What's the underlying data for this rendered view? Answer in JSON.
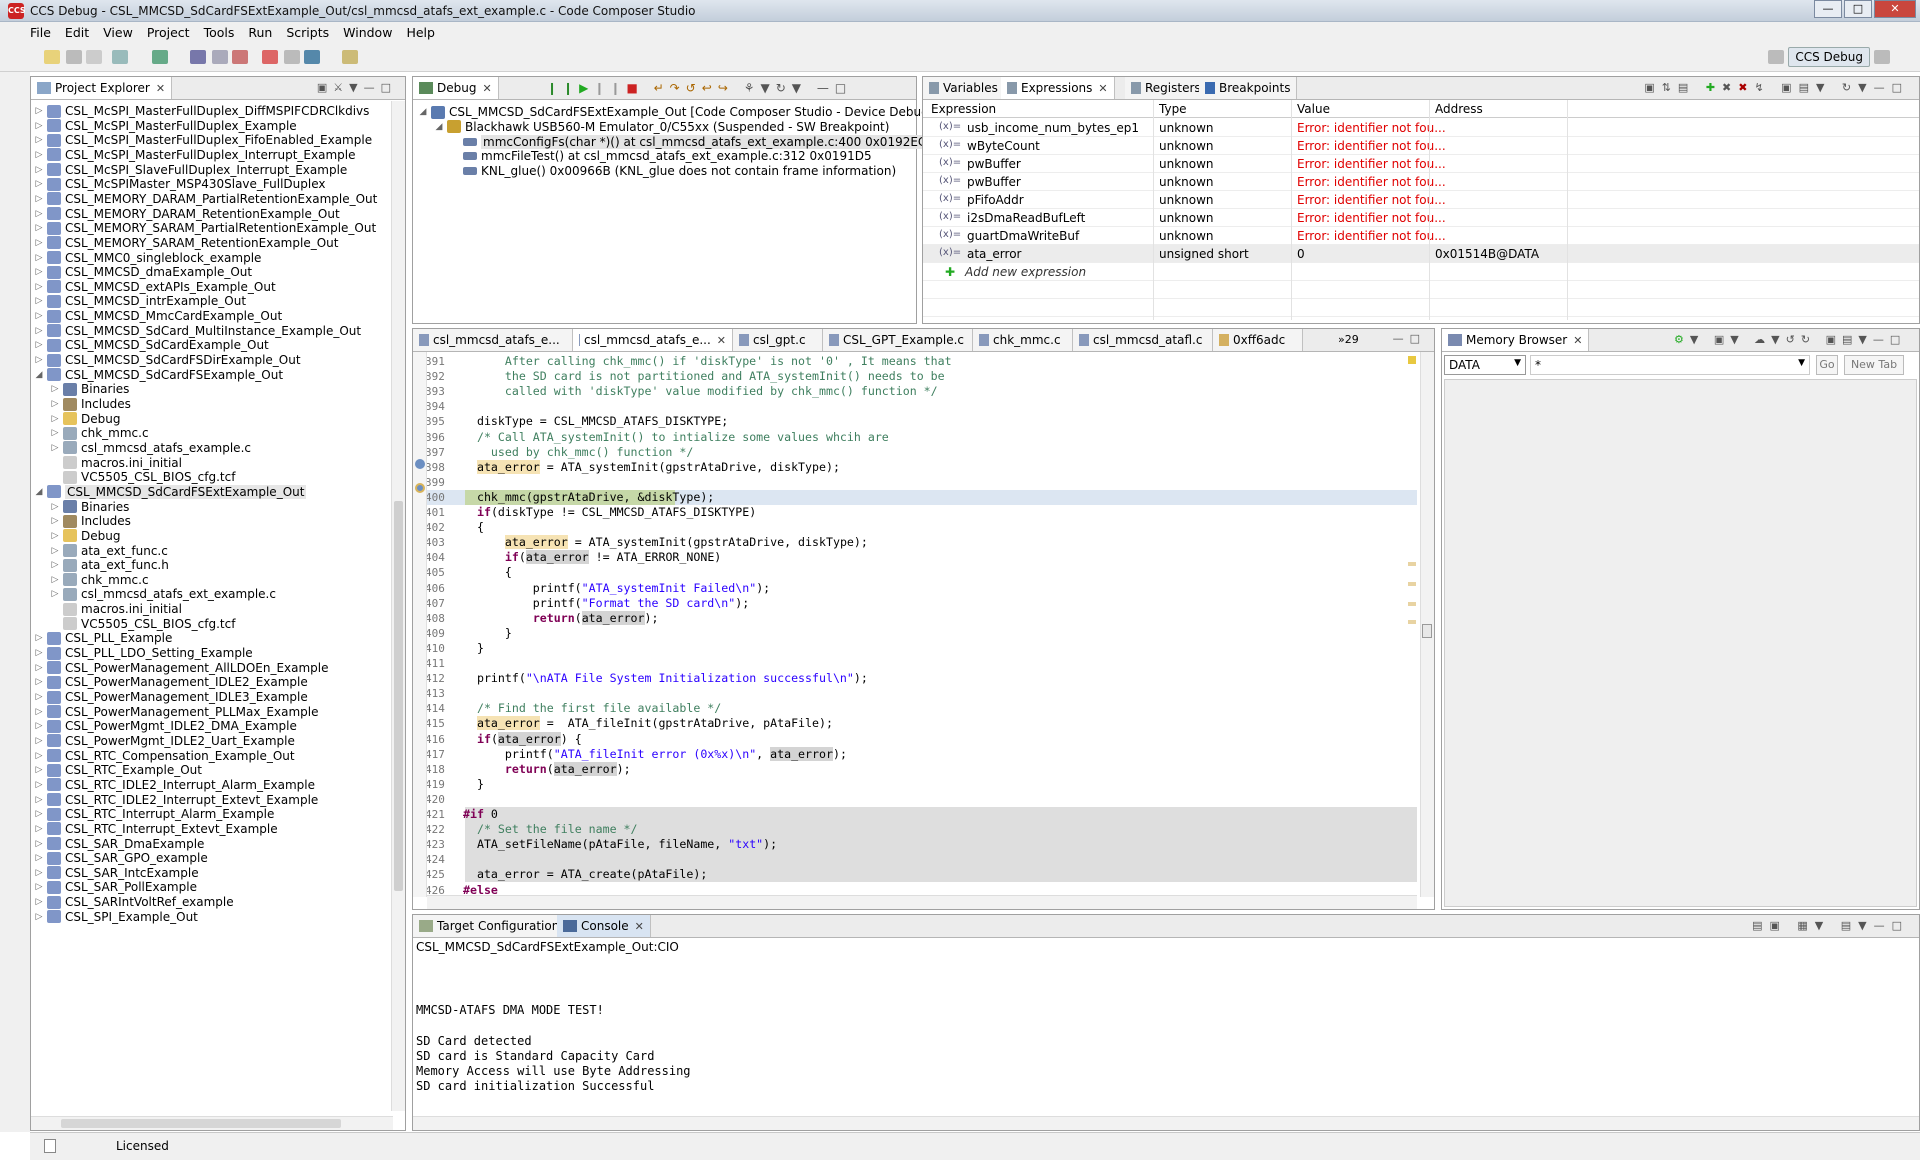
{
  "window": {
    "title": "CCS Debug - CSL_MMCSD_SdCardFSExtExample_Out/csl_mmcsd_atafs_ext_example.c - Code Composer Studio",
    "app_icon": "CCS"
  },
  "menu": [
    "File",
    "Edit",
    "View",
    "Project",
    "Tools",
    "Run",
    "Scripts",
    "Window",
    "Help"
  ],
  "perspective": {
    "label": "CCS Debug"
  },
  "project_explorer": {
    "tab": "Project Explorer",
    "items": [
      {
        "label": "CSL_McSPI_MasterFullDuplex_DiffMSPIFCDRClkdivs",
        "level": 0,
        "exp": "c",
        "kind": "proj"
      },
      {
        "label": "CSL_McSPI_MasterFullDuplex_Example",
        "level": 0,
        "exp": "c",
        "kind": "proj"
      },
      {
        "label": "CSL_McSPI_MasterFullDuplex_FifoEnabled_Example",
        "level": 0,
        "exp": "c",
        "kind": "proj"
      },
      {
        "label": "CSL_McSPI_MasterFullDuplex_Interrupt_Example",
        "level": 0,
        "exp": "c",
        "kind": "proj"
      },
      {
        "label": "CSL_McSPI_SlaveFullDuplex_Interrupt_Example",
        "level": 0,
        "exp": "c",
        "kind": "proj"
      },
      {
        "label": "CSL_McSPIMaster_MSP430Slave_FullDuplex",
        "level": 0,
        "exp": "c",
        "kind": "proj"
      },
      {
        "label": "CSL_MEMORY_DARAM_PartialRetentionExample_Out",
        "level": 0,
        "exp": "c",
        "kind": "proj"
      },
      {
        "label": "CSL_MEMORY_DARAM_RetentionExample_Out",
        "level": 0,
        "exp": "c",
        "kind": "proj"
      },
      {
        "label": "CSL_MEMORY_SARAM_PartialRetentionExample_Out",
        "level": 0,
        "exp": "c",
        "kind": "proj"
      },
      {
        "label": "CSL_MEMORY_SARAM_RetentionExample_Out",
        "level": 0,
        "exp": "c",
        "kind": "proj"
      },
      {
        "label": "CSL_MMC0_singleblock_example",
        "level": 0,
        "exp": "c",
        "kind": "proj"
      },
      {
        "label": "CSL_MMCSD_dmaExample_Out",
        "level": 0,
        "exp": "c",
        "kind": "proj"
      },
      {
        "label": "CSL_MMCSD_extAPIs_Example_Out",
        "level": 0,
        "exp": "c",
        "kind": "proj"
      },
      {
        "label": "CSL_MMCSD_intrExample_Out",
        "level": 0,
        "exp": "c",
        "kind": "proj"
      },
      {
        "label": "CSL_MMCSD_MmcCardExample_Out",
        "level": 0,
        "exp": "c",
        "kind": "proj"
      },
      {
        "label": "CSL_MMCSD_SdCard_MultiInstance_Example_Out",
        "level": 0,
        "exp": "c",
        "kind": "proj"
      },
      {
        "label": "CSL_MMCSD_SdCardExample_Out",
        "level": 0,
        "exp": "c",
        "kind": "proj"
      },
      {
        "label": "CSL_MMCSD_SdCardFSDirExample_Out",
        "level": 0,
        "exp": "c",
        "kind": "proj"
      },
      {
        "label": "CSL_MMCSD_SdCardFSExample_Out",
        "level": 0,
        "exp": "o",
        "kind": "proj"
      },
      {
        "label": "Binaries",
        "level": 1,
        "exp": "c",
        "kind": "bin"
      },
      {
        "label": "Includes",
        "level": 1,
        "exp": "c",
        "kind": "inc"
      },
      {
        "label": "Debug",
        "level": 1,
        "exp": "c",
        "kind": "folder"
      },
      {
        "label": "chk_mmc.c",
        "level": 1,
        "exp": "c",
        "kind": "c"
      },
      {
        "label": "csl_mmcsd_atafs_example.c",
        "level": 1,
        "exp": "c",
        "kind": "c"
      },
      {
        "label": "macros.ini_initial",
        "level": 1,
        "exp": "n",
        "kind": "file"
      },
      {
        "label": "VC5505_CSL_BIOS_cfg.tcf",
        "level": 1,
        "exp": "n",
        "kind": "file"
      },
      {
        "label": "CSL_MMCSD_SdCardFSExtExample_Out",
        "level": 0,
        "exp": "o",
        "kind": "proj",
        "sel": true
      },
      {
        "label": "Binaries",
        "level": 1,
        "exp": "c",
        "kind": "bin"
      },
      {
        "label": "Includes",
        "level": 1,
        "exp": "c",
        "kind": "inc"
      },
      {
        "label": "Debug",
        "level": 1,
        "exp": "c",
        "kind": "folder"
      },
      {
        "label": "ata_ext_func.c",
        "level": 1,
        "exp": "c",
        "kind": "c"
      },
      {
        "label": "ata_ext_func.h",
        "level": 1,
        "exp": "c",
        "kind": "h"
      },
      {
        "label": "chk_mmc.c",
        "level": 1,
        "exp": "c",
        "kind": "c"
      },
      {
        "label": "csl_mmcsd_atafs_ext_example.c",
        "level": 1,
        "exp": "c",
        "kind": "c"
      },
      {
        "label": "macros.ini_initial",
        "level": 1,
        "exp": "n",
        "kind": "file"
      },
      {
        "label": "VC5505_CSL_BIOS_cfg.tcf",
        "level": 1,
        "exp": "n",
        "kind": "file"
      },
      {
        "label": "CSL_PLL_Example",
        "level": 0,
        "exp": "c",
        "kind": "proj"
      },
      {
        "label": "CSL_PLL_LDO_Setting_Example",
        "level": 0,
        "exp": "c",
        "kind": "proj"
      },
      {
        "label": "CSL_PowerManagement_AllLDOEn_Example",
        "level": 0,
        "exp": "c",
        "kind": "proj"
      },
      {
        "label": "CSL_PowerManagement_IDLE2_Example",
        "level": 0,
        "exp": "c",
        "kind": "proj"
      },
      {
        "label": "CSL_PowerManagement_IDLE3_Example",
        "level": 0,
        "exp": "c",
        "kind": "proj"
      },
      {
        "label": "CSL_PowerManagement_PLLMax_Example",
        "level": 0,
        "exp": "c",
        "kind": "proj"
      },
      {
        "label": "CSL_PowerMgmt_IDLE2_DMA_Example",
        "level": 0,
        "exp": "c",
        "kind": "proj"
      },
      {
        "label": "CSL_PowerMgmt_IDLE2_Uart_Example",
        "level": 0,
        "exp": "c",
        "kind": "proj"
      },
      {
        "label": "CSL_RTC_Compensation_Example_Out",
        "level": 0,
        "exp": "c",
        "kind": "proj"
      },
      {
        "label": "CSL_RTC_Example_Out",
        "level": 0,
        "exp": "c",
        "kind": "proj"
      },
      {
        "label": "CSL_RTC_IDLE2_Interrupt_Alarm_Example",
        "level": 0,
        "exp": "c",
        "kind": "proj"
      },
      {
        "label": "CSL_RTC_IDLE2_Interrupt_Extevt_Example",
        "level": 0,
        "exp": "c",
        "kind": "proj"
      },
      {
        "label": "CSL_RTC_Interrupt_Alarm_Example",
        "level": 0,
        "exp": "c",
        "kind": "proj"
      },
      {
        "label": "CSL_RTC_Interrupt_Extevt_Example",
        "level": 0,
        "exp": "c",
        "kind": "proj"
      },
      {
        "label": "CSL_SAR_DmaExample",
        "level": 0,
        "exp": "c",
        "kind": "proj"
      },
      {
        "label": "CSL_SAR_GPO_example",
        "level": 0,
        "exp": "c",
        "kind": "proj"
      },
      {
        "label": "CSL_SAR_IntcExample",
        "level": 0,
        "exp": "c",
        "kind": "proj"
      },
      {
        "label": "CSL_SAR_PollExample",
        "level": 0,
        "exp": "c",
        "kind": "proj"
      },
      {
        "label": "CSL_SARIntVoltRef_example",
        "level": 0,
        "exp": "c",
        "kind": "proj"
      },
      {
        "label": "CSL_SPI_Example_Out",
        "level": 0,
        "exp": "c",
        "kind": "proj"
      }
    ]
  },
  "debug_view": {
    "tab": "Debug",
    "items": [
      {
        "label": "CSL_MMCSD_SdCardFSExtExample_Out [Code Composer Studio - Device Debugging]",
        "level": 0,
        "kind": "session"
      },
      {
        "label": "Blackhawk USB560-M Emulator_0/C55xx (Suspended - SW Breakpoint)",
        "level": 1,
        "kind": "thread"
      },
      {
        "label": "mmcConfigFs(char *)() at csl_mmcsd_atafs_ext_example.c:400 0x0192EC",
        "level": 2,
        "kind": "frame",
        "sel": true
      },
      {
        "label": "mmcFileTest() at csl_mmcsd_atafs_ext_example.c:312 0x0191D5",
        "level": 2,
        "kind": "frame"
      },
      {
        "label": "KNL_glue() 0x00966B  (KNL_glue does not contain frame information)",
        "level": 2,
        "kind": "frame"
      }
    ]
  },
  "expressions_view": {
    "tabs": [
      "Variables",
      "Expressions",
      "Registers",
      "Breakpoints"
    ],
    "columns": [
      "Expression",
      "Type",
      "Value",
      "Address"
    ],
    "rows": [
      {
        "expr": "usb_income_num_bytes_ep1",
        "type": "unknown",
        "value": "Error: identifier not fou...",
        "addr": "",
        "error": true
      },
      {
        "expr": "wByteCount",
        "type": "unknown",
        "value": "Error: identifier not fou...",
        "addr": "",
        "error": true
      },
      {
        "expr": "pwBuffer",
        "type": "unknown",
        "value": "Error: identifier not fou...",
        "addr": "",
        "error": true
      },
      {
        "expr": "pwBuffer",
        "type": "unknown",
        "value": "Error: identifier not fou...",
        "addr": "",
        "error": true
      },
      {
        "expr": "pFifoAddr",
        "type": "unknown",
        "value": "Error: identifier not fou...",
        "addr": "",
        "error": true
      },
      {
        "expr": "i2sDmaReadBufLeft",
        "type": "unknown",
        "value": "Error: identifier not fou...",
        "addr": "",
        "error": true
      },
      {
        "expr": "guartDmaWriteBuf",
        "type": "unknown",
        "value": "Error: identifier not fou...",
        "addr": "",
        "error": true
      },
      {
        "expr": "ata_error",
        "type": "unsigned short",
        "value": "0",
        "addr": "0x01514B@DATA",
        "error": false
      }
    ],
    "add_new": "Add new expression"
  },
  "editor": {
    "tabs": [
      "csl_mmcsd_atafs_e...",
      "csl_mmcsd_atafs_e...",
      "csl_gpt.c",
      "CSL_GPT_Example.c",
      "chk_mmc.c",
      "csl_mmcsd_atafl.c",
      "0xff6adc"
    ],
    "overflow": "»29",
    "lines": [
      {
        "n": "391",
        "html": "<span class='cm'>      After calling chk_mmc() if 'diskType' is not '0' , It means that</span>"
      },
      {
        "n": "392",
        "html": "<span class='cm'>      the SD card is not partitioned and ATA_systemInit() needs to be</span>"
      },
      {
        "n": "393",
        "html": "<span class='cm'>      called with 'diskType' value modified by chk_mmc() function */</span>"
      },
      {
        "n": "394",
        "html": ""
      },
      {
        "n": "395",
        "html": "  diskType = CSL_MMCSD_ATAFS_DISKTYPE;"
      },
      {
        "n": "396",
        "html": "  <span class='cm'>/* Call ATA_systemInit() to intialize some values whcih are</span>"
      },
      {
        "n": "397",
        "html": "<span class='cm'>    used by chk_mmc() function */</span>"
      },
      {
        "n": "398",
        "html": "  <span class='hl'>ata_error</span> = ATA_systemInit(gpstrAtaDrive, diskType);"
      },
      {
        "n": "399",
        "html": ""
      },
      {
        "n": "400",
        "html": "  chk_mmc(gpstrAtaDrive, &amp;diskType);",
        "current": true
      },
      {
        "n": "401",
        "html": "  <span class='kw'>if</span>(diskType != CSL_MMCSD_ATAFS_DISKTYPE)"
      },
      {
        "n": "402",
        "html": "  {"
      },
      {
        "n": "403",
        "html": "      <span class='hl'>ata_error</span> = ATA_systemInit(gpstrAtaDrive, diskType);"
      },
      {
        "n": "404",
        "html": "      <span class='kw'>if</span>(<span class='hl2'>ata_error</span> != ATA_ERROR_NONE)"
      },
      {
        "n": "405",
        "html": "      {"
      },
      {
        "n": "406",
        "html": "          printf(<span class='st'>\"ATA_systemInit Failed\\n\"</span>);"
      },
      {
        "n": "407",
        "html": "          printf(<span class='st'>\"Format the SD card\\n\"</span>);"
      },
      {
        "n": "408",
        "html": "          <span class='kw'>return</span>(<span class='hl2'>ata_error</span>);"
      },
      {
        "n": "409",
        "html": "      }"
      },
      {
        "n": "410",
        "html": "  }"
      },
      {
        "n": "411",
        "html": ""
      },
      {
        "n": "412",
        "html": "  printf(<span class='st'>\"\\nATA File System Initialization successful\\n\"</span>);"
      },
      {
        "n": "413",
        "html": ""
      },
      {
        "n": "414",
        "html": "  <span class='cm'>/* Find the first file available */</span>"
      },
      {
        "n": "415",
        "html": "  <span class='hl'>ata_error</span> =  ATA_fileInit(gpstrAtaDrive, pAtaFile);"
      },
      {
        "n": "416",
        "html": "  <span class='kw'>if</span>(<span class='hl2'>ata_error</span>) {"
      },
      {
        "n": "417",
        "html": "      printf(<span class='st'>\"ATA_fileInit error (0x%x)\\n\"</span>, <span class='hl2'>ata_error</span>);"
      },
      {
        "n": "418",
        "html": "      <span class='kw'>return</span>(<span class='hl2'>ata_error</span>);"
      },
      {
        "n": "419",
        "html": "  }"
      },
      {
        "n": "420",
        "html": ""
      },
      {
        "n": "421",
        "html": "<span class='pp'>#if</span> 0",
        "inactive": true
      },
      {
        "n": "422",
        "html": "  <span class='cm'>/* Set the file name */</span>",
        "inactive": true
      },
      {
        "n": "423",
        "html": "  ATA_setFileName(pAtaFile, fileName, <span class='st'>\"txt\"</span>);",
        "inactive": true
      },
      {
        "n": "424",
        "html": "",
        "inactive": true
      },
      {
        "n": "425",
        "html": "  ata_error = ATA_create(pAtaFile);",
        "inactive": true
      },
      {
        "n": "426",
        "html": "<span class='pp'>#else</span>"
      }
    ]
  },
  "memory_browser": {
    "tab": "Memory Browser",
    "page": "DATA",
    "address_placeholder": "*",
    "go": "Go",
    "new_tab": "New Tab"
  },
  "console": {
    "tabs": [
      "Target Configurations",
      "Console"
    ],
    "header": "CSL_MMCSD_SdCardFSExtExample_Out:CIO",
    "lines": [
      "",
      "",
      "",
      "MMCSD-ATAFS DMA MODE TEST!",
      "",
      "SD Card detected",
      "SD card is Standard Capacity Card",
      "Memory Access will use Byte Addressing",
      "SD card initialization Successful"
    ]
  },
  "status": {
    "text": "Licensed"
  }
}
